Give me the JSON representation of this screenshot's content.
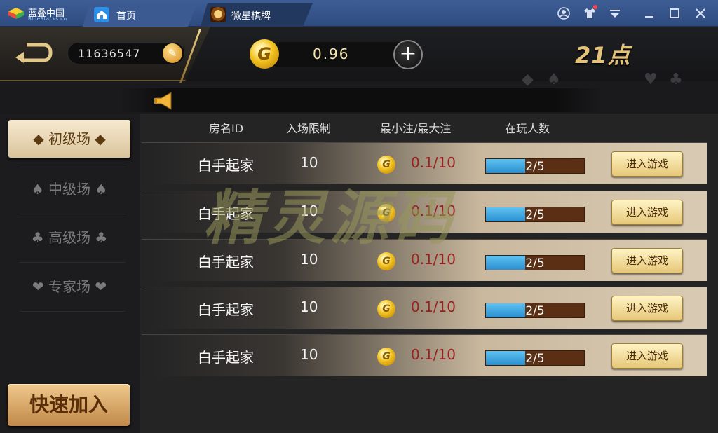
{
  "emulator": {
    "brand": "蓝叠中国",
    "brand_sub": "BlueStacks.cn",
    "tabs": [
      {
        "label": "首页",
        "icon": "home-icon"
      },
      {
        "label": "微星棋牌",
        "icon": "game-app-icon"
      }
    ],
    "toolbar_icons": [
      "account-icon",
      "shirt-icon",
      "menu-dropdown-icon",
      "minimize-icon",
      "maximize-icon",
      "close-icon"
    ]
  },
  "header": {
    "player_id": "11636547",
    "balance": "0.96",
    "game_title": "21点",
    "coin_symbol": "G"
  },
  "menu": {
    "items": [
      {
        "label": "初级场",
        "suit": "◆",
        "active": true
      },
      {
        "label": "中级场",
        "suit": "♠",
        "active": false
      },
      {
        "label": "高级场",
        "suit": "♣",
        "active": false
      },
      {
        "label": "专家场",
        "suit": "❤",
        "active": false
      }
    ],
    "quick_join": "快速加入"
  },
  "table": {
    "headers": [
      "房名ID",
      "入场限制",
      "最小注/最大注",
      "在玩人数"
    ],
    "rows": [
      {
        "name": "白手起家",
        "limit": "10",
        "bet": "0.1/10",
        "players": "2/5",
        "fill": 0.4,
        "button": "进入游戏"
      },
      {
        "name": "白手起家",
        "limit": "10",
        "bet": "0.1/10",
        "players": "2/5",
        "fill": 0.4,
        "button": "进入游戏"
      },
      {
        "name": "白手起家",
        "limit": "10",
        "bet": "0.1/10",
        "players": "2/5",
        "fill": 0.4,
        "button": "进入游戏"
      },
      {
        "name": "白手起家",
        "limit": "10",
        "bet": "0.1/10",
        "players": "2/5",
        "fill": 0.4,
        "button": "进入游戏"
      },
      {
        "name": "白手起家",
        "limit": "10",
        "bet": "0.1/10",
        "players": "2/5",
        "fill": 0.4,
        "button": "进入游戏"
      }
    ]
  },
  "watermark": "精灵源码",
  "colors": {
    "titlebar": "#2f4c80",
    "gold": "#e5c27a",
    "bet_text": "#9c1f1f",
    "bar_fill": "#2a8fcf",
    "bar_bg": "#5a2f14"
  }
}
